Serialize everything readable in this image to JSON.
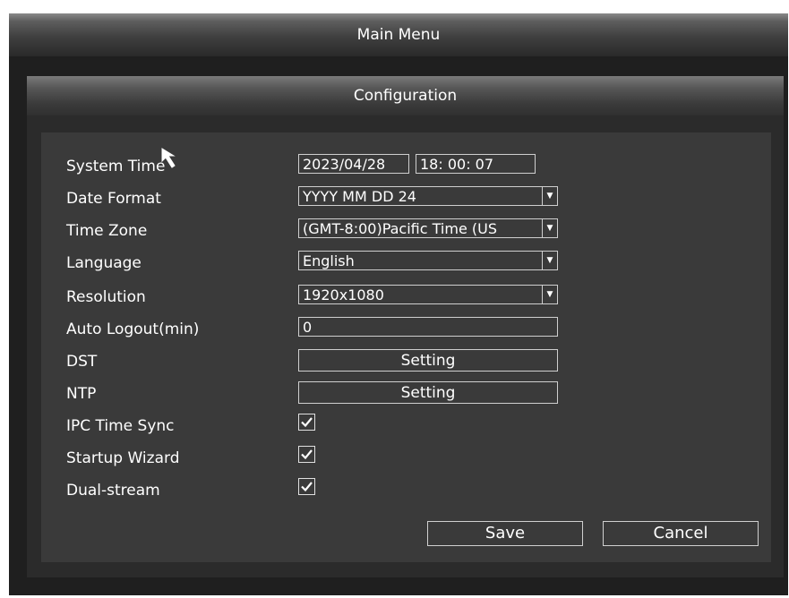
{
  "window": {
    "title": "Main Menu"
  },
  "panel": {
    "title": "Configuration"
  },
  "fields": {
    "system_time": {
      "label": "System Time",
      "date": "2023/04/28",
      "time": "18: 00: 07"
    },
    "date_format": {
      "label": "Date Format",
      "value": "YYYY MM DD 24"
    },
    "time_zone": {
      "label": "Time Zone",
      "value": "(GMT-8:00)Pacific Time (US"
    },
    "language": {
      "label": "Language",
      "value": "English"
    },
    "resolution": {
      "label": "Resolution",
      "value": "1920x1080"
    },
    "auto_logout": {
      "label": "Auto Logout(min)",
      "value": "0"
    },
    "dst": {
      "label": "DST",
      "button": "Setting"
    },
    "ntp": {
      "label": "NTP",
      "button": "Setting"
    },
    "ipc_time_sync": {
      "label": "IPC Time Sync",
      "checked": true
    },
    "startup_wizard": {
      "label": "Startup Wizard",
      "checked": true
    },
    "dual_stream": {
      "label": "Dual-stream",
      "checked": true
    }
  },
  "actions": {
    "save": "Save",
    "cancel": "Cancel"
  },
  "icons": {
    "dropdown": "chevron-down-icon",
    "checkbox": "checkmark-icon",
    "pointer": "mouse-cursor-icon"
  },
  "colors": {
    "background": "#3a3a3a",
    "text": "#ffffff",
    "border": "#cfcfcf"
  }
}
